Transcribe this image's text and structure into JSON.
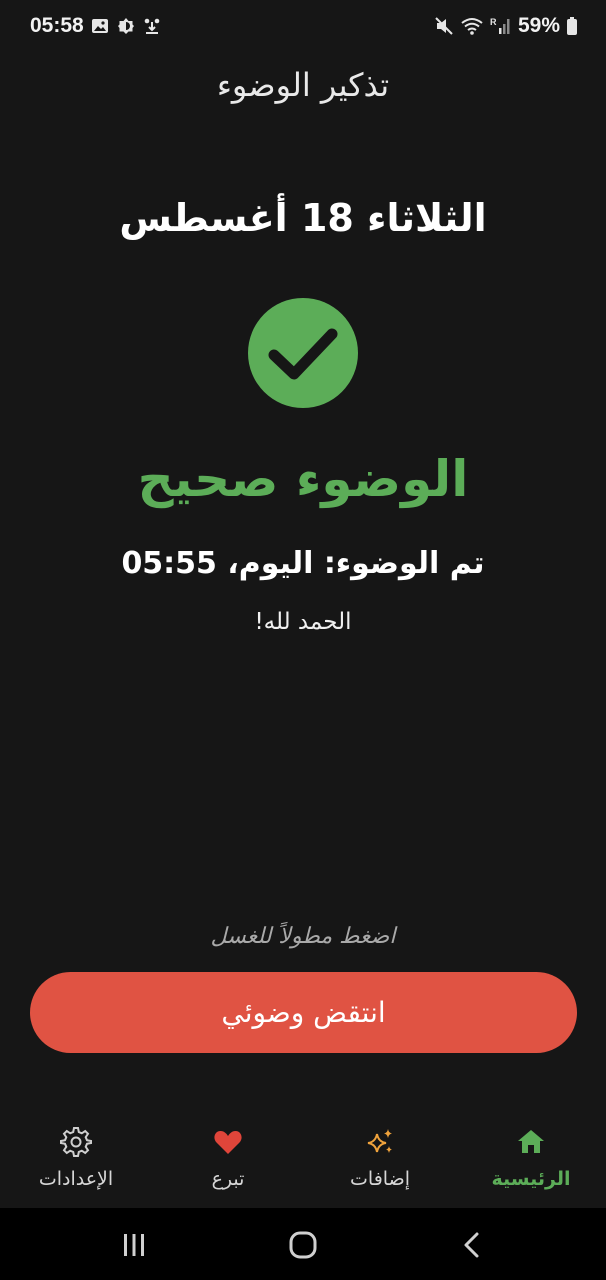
{
  "status_bar": {
    "time": "05:58",
    "battery": "59%"
  },
  "app": {
    "title": "تذكير الوضوء"
  },
  "main": {
    "date": "الثلاثاء 18 أغسطس",
    "status_title": "الوضوء صحيح",
    "wudu_time": "تم الوضوء: اليوم، 05:55",
    "praise": "الحمد لله!",
    "hint": "اضغط مطولاً للغسل",
    "break_button_label": "انتقض وضوئي"
  },
  "bottom_nav": {
    "items": [
      {
        "label": "الرئيسية",
        "icon": "home-icon",
        "active": true
      },
      {
        "label": "إضافات",
        "icon": "sparkles-icon",
        "active": false
      },
      {
        "label": "تبرع",
        "icon": "heart-icon",
        "active": false
      },
      {
        "label": "الإعدادات",
        "icon": "gear-icon",
        "active": false
      }
    ]
  },
  "colors": {
    "background": "#161616",
    "accent_green": "#5cad58",
    "button_red": "#e05343",
    "sparkle_orange": "#f0a33c",
    "heart_red": "#e0453a"
  }
}
